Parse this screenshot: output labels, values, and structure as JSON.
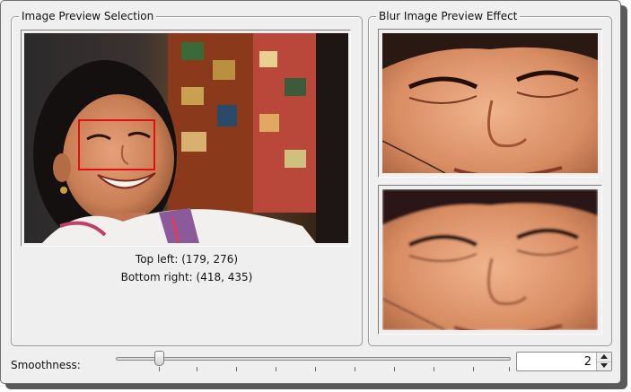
{
  "selection_panel": {
    "title": "Image Preview Selection",
    "top_left": "Top left: (179, 276)",
    "bottom_right": "Bottom right: (418, 435)"
  },
  "effect_panel": {
    "title": "Blur Image Preview Effect"
  },
  "smoothness": {
    "label": "Smoothness:",
    "value": "2",
    "slider_fraction": 0.11,
    "tick_count": 10
  },
  "colors": {
    "selection_rect": "#e01010",
    "window_bg": "#efefef"
  },
  "icons": [
    "spin-up-icon",
    "spin-down-icon"
  ]
}
